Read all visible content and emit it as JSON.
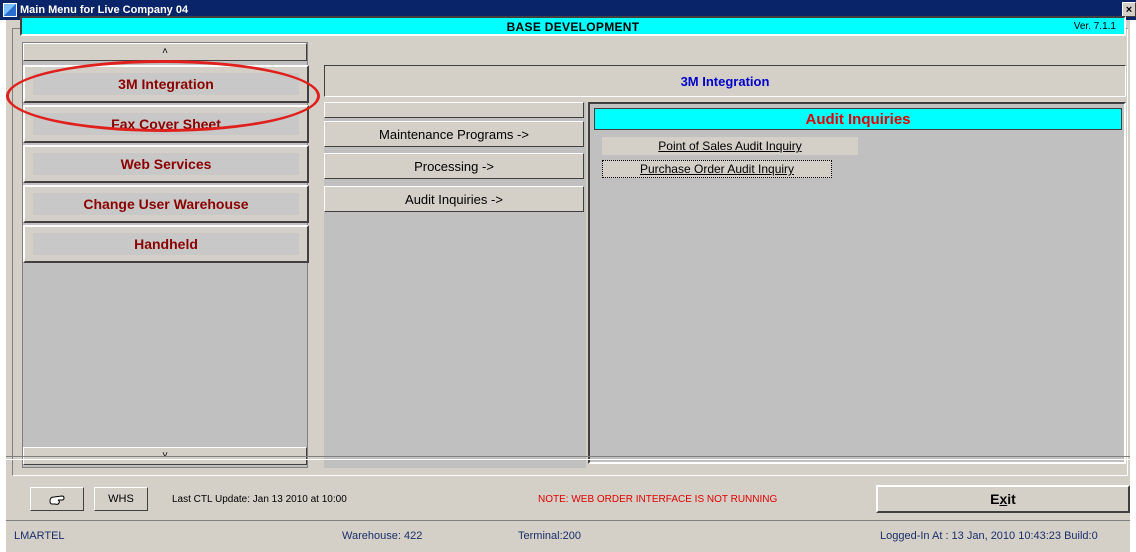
{
  "window": {
    "title": "Main Menu for Live Company 04",
    "close_label": "×"
  },
  "header": {
    "title": "BASE DEVELOPMENT",
    "version": "Ver. 7.1.1"
  },
  "left_menu": {
    "scroll_up": "˄",
    "scroll_down": "˅",
    "items": [
      {
        "label": "3M Integration"
      },
      {
        "label": "Fax Cover Sheet"
      },
      {
        "label": "Web Services"
      },
      {
        "label": "Change User Warehouse"
      },
      {
        "label": "Handheld"
      }
    ]
  },
  "module": {
    "title": "3M Integration",
    "submenus": [
      {
        "label": "Maintenance Programs ->"
      },
      {
        "label": "Processing ->"
      },
      {
        "label": "Audit Inquiries ->"
      }
    ]
  },
  "audit": {
    "title": "Audit Inquiries",
    "items": [
      {
        "label": "Point of Sales Audit Inquiry"
      },
      {
        "label": "Purchase Order Audit Inquiry"
      }
    ]
  },
  "footer": {
    "whs_label": "WHS",
    "ctl_update": "Last CTL Update: Jan 13 2010 at 10:00",
    "note": "NOTE: WEB ORDER INTERFACE IS NOT RUNNING",
    "exit_label": "Exit"
  },
  "status": {
    "user": "LMARTEL",
    "warehouse": "Warehouse: 422",
    "terminal": "Terminal:200",
    "logged_in": "Logged-In At : 13 Jan, 2010   10:43:23   Build:0"
  },
  "colors": {
    "title_bar": "#0a246a",
    "header_bg": "#00ffff",
    "menu_text": "#8b0000",
    "module_title_text": "#0000cc",
    "audit_title_text": "#e00000",
    "highlight_ring": "#e0201c"
  }
}
